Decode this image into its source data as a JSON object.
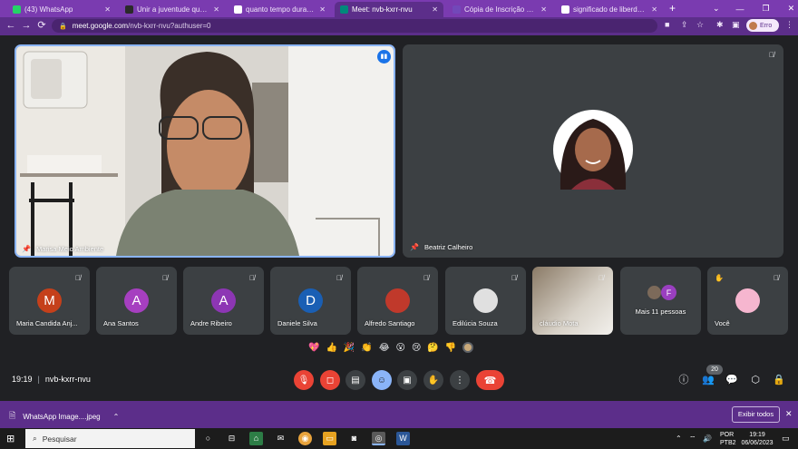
{
  "browser": {
    "tabs": [
      {
        "label": "(43) WhatsApp",
        "fav_color": "#25d366",
        "active": false
      },
      {
        "label": "Unir a juventude que trabalha",
        "fav_color": "#2a2a2a",
        "active": false
      },
      {
        "label": "quanto tempo dura reunião do",
        "fav_color": "#ffffff",
        "active": false
      },
      {
        "label": "Meet: nvb-kxrr-nvu",
        "fav_color": "#00897b",
        "active": true
      },
      {
        "label": "Cópia de Inscrição no evento",
        "fav_color": "#7248b9",
        "active": false
      },
      {
        "label": "significado de liberdade de co",
        "fav_color": "#ffffff",
        "active": false
      }
    ],
    "tab_close": "✕",
    "new_tab": "+",
    "url_host": "meet.google.com",
    "url_path": "/nvb-kxrr-nvu?authuser=0",
    "profile_label": "Erro"
  },
  "meet": {
    "main_tiles": [
      {
        "name": "Marisa Meio Ambiente"
      },
      {
        "name": "Beatriz Calheiro"
      }
    ],
    "participants": [
      {
        "name": "Maria Candida Anj...",
        "initial": "M",
        "color": "#c5401b"
      },
      {
        "name": "Ana Santos",
        "initial": "A",
        "color": "#a63fc0"
      },
      {
        "name": "Andre Ribeiro",
        "initial": "A",
        "color": "#8d36b4"
      },
      {
        "name": "Daniele Silva",
        "initial": "D",
        "color": "#1a5fb4"
      },
      {
        "name": "Alfredo Santiago",
        "initial": "",
        "color": "#c0392b"
      },
      {
        "name": "Edilúcia Souza",
        "initial": "",
        "color": "#e0e0e0"
      },
      {
        "name": "cláudio Mota",
        "initial": "",
        "color": "#6b5a4a"
      },
      {
        "name": "Mais 11 pessoas",
        "initial": "F",
        "color": "#9a3fc0"
      },
      {
        "name": "Você",
        "initial": "",
        "color": "#f6b6cf"
      }
    ],
    "reactions": [
      "💖",
      "👍",
      "🎉",
      "👏",
      "😂",
      "😮",
      "😢",
      "🤔",
      "👎"
    ],
    "time": "19:19",
    "meeting_code": "nvb-kxrr-nvu",
    "people_count": "20"
  },
  "download": {
    "file_name": "WhatsApp Image....jpeg",
    "show_all": "Exibir todos"
  },
  "taskbar": {
    "search_placeholder": "Pesquisar",
    "lang_1": "POR",
    "lang_2": "PTB2",
    "time": "19:19",
    "date": "06/06/2023"
  }
}
